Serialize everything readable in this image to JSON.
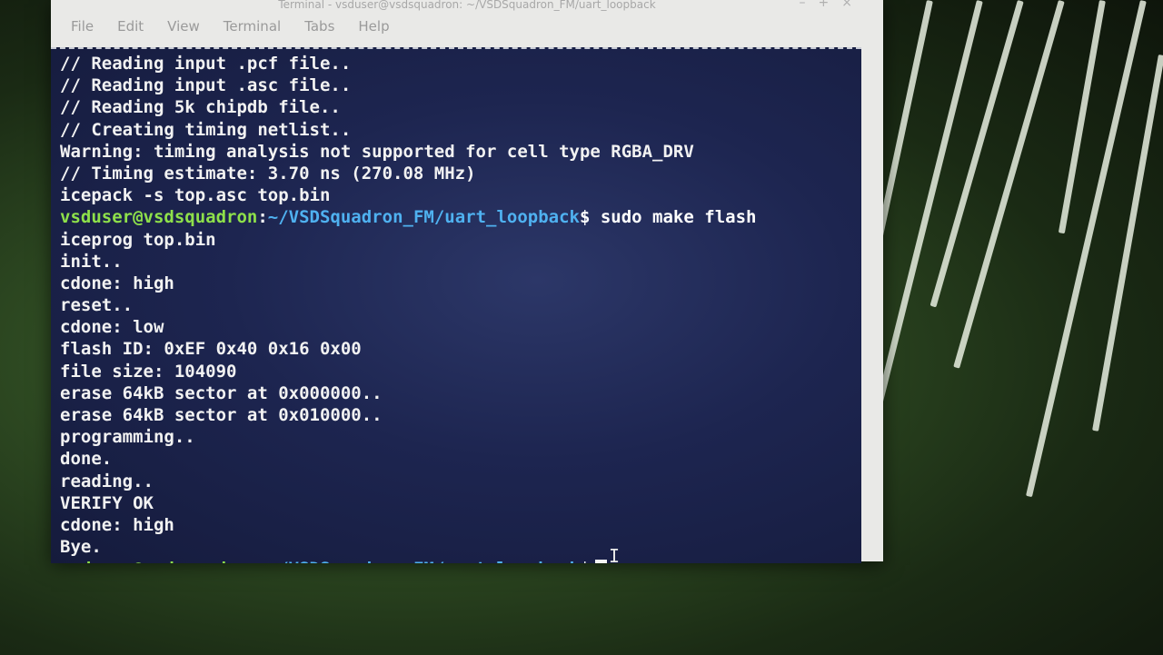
{
  "window": {
    "title": "Terminal - vsduser@vsdsquadron: ~/VSDSquadron_FM/uart_loopback"
  },
  "menubar": {
    "items": [
      "File",
      "Edit",
      "View",
      "Terminal",
      "Tabs",
      "Help"
    ]
  },
  "terminal": {
    "lines": [
      {
        "type": "text",
        "text": "// Reading input .pcf file.."
      },
      {
        "type": "text",
        "text": "// Reading input .asc file.."
      },
      {
        "type": "text",
        "text": "// Reading 5k chipdb file.."
      },
      {
        "type": "text",
        "text": "// Creating timing netlist.."
      },
      {
        "type": "text",
        "text": "Warning: timing analysis not supported for cell type RGBA_DRV"
      },
      {
        "type": "text",
        "text": "// Timing estimate: 3.70 ns (270.08 MHz)"
      },
      {
        "type": "text",
        "text": "icepack -s top.asc top.bin"
      },
      {
        "type": "prompt",
        "user": "vsduser@vsdsquadron",
        "sep": ":",
        "path": "~/VSDSquadron_FM/uart_loopback",
        "dollar": "$ ",
        "cmd": "sudo make flash"
      },
      {
        "type": "text",
        "text": "iceprog top.bin"
      },
      {
        "type": "text",
        "text": "init.."
      },
      {
        "type": "text",
        "text": "cdone: high"
      },
      {
        "type": "text",
        "text": "reset.."
      },
      {
        "type": "text",
        "text": "cdone: low"
      },
      {
        "type": "text",
        "text": "flash ID: 0xEF 0x40 0x16 0x00"
      },
      {
        "type": "text",
        "text": "file size: 104090"
      },
      {
        "type": "text",
        "text": "erase 64kB sector at 0x000000.."
      },
      {
        "type": "text",
        "text": "erase 64kB sector at 0x010000.."
      },
      {
        "type": "text",
        "text": "programming.."
      },
      {
        "type": "text",
        "text": "done."
      },
      {
        "type": "text",
        "text": "reading.."
      },
      {
        "type": "text",
        "text": "VERIFY OK"
      },
      {
        "type": "text",
        "text": "cdone: high"
      },
      {
        "type": "text",
        "text": "Bye."
      },
      {
        "type": "prompt",
        "user": "vsduser@vsdsquadron",
        "sep": ":",
        "path": "~/VSDSquadron_FM/uart_loopback",
        "dollar": "$",
        "cmd": "",
        "cursor": true
      }
    ]
  },
  "colors": {
    "terminal_bg": "#1d2550",
    "prompt_user": "#8ee04a",
    "prompt_path": "#4fb1f0",
    "text": "#f2f2f2",
    "desktop_bg": "#2e4a22"
  },
  "icons": {
    "window_controls": [
      "minimize-icon",
      "maximize-icon",
      "close-icon"
    ],
    "mouse_pointer": "ibeam-cursor-icon"
  }
}
